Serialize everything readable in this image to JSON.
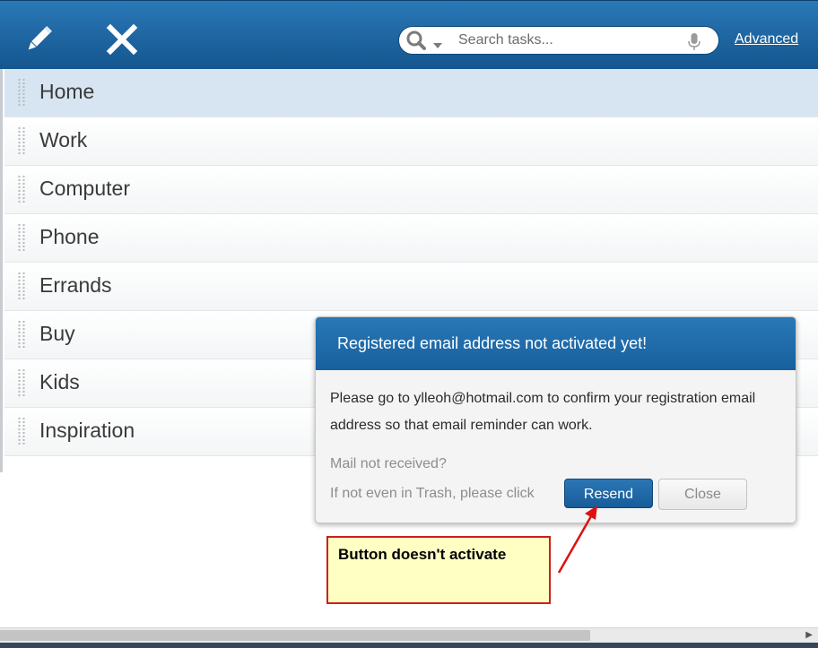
{
  "toolbar": {
    "edit_icon": "pencil-icon",
    "delete_icon": "close-icon",
    "search": {
      "placeholder": "Search tasks...",
      "value": ""
    },
    "advanced_label": "Advanced"
  },
  "lists": [
    {
      "label": "Home",
      "selected": true
    },
    {
      "label": "Work"
    },
    {
      "label": "Computer"
    },
    {
      "label": "Phone"
    },
    {
      "label": "Errands"
    },
    {
      "label": "Buy"
    },
    {
      "label": "Kids"
    },
    {
      "label": "Inspiration"
    }
  ],
  "dialog": {
    "title": "Registered email address not activated yet!",
    "body": "Please go to ylleoh@hotmail.com to confirm your registration email address so that email reminder can work.",
    "mail_not_received": "Mail not received?",
    "trash_hint": "If not even in Trash, please click",
    "resend_label": "Resend",
    "close_label": "Close"
  },
  "annotation": {
    "text": "Button doesn't activate"
  },
  "colors": {
    "accent": "#1d67a6",
    "selected_row": "#d6e5f1",
    "note_background": "#ffffc4",
    "note_border": "#cc1f1f"
  }
}
